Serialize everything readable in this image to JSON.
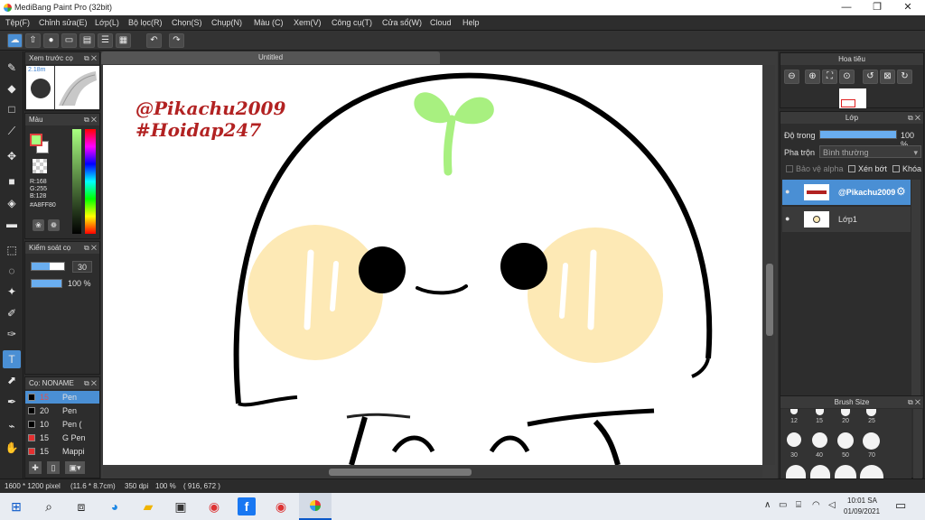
{
  "window": {
    "title": "MediBang Paint Pro (32bit)",
    "minimize": "—",
    "maximize": "❐",
    "close": "✕"
  },
  "menu": [
    "Tệp(F)",
    "Chỉnh sửa(E)",
    "Lớp(L)",
    "Bộ lọc(R)",
    "Chọn(S)",
    "Chụp(N)",
    "Màu (C)",
    "Xem(V)",
    "Công cụ(T)",
    "Cửa sổ(W)",
    "Cloud",
    "Help"
  ],
  "toolbar": {
    "icons": [
      "cloud-icon",
      "share-icon",
      "chat-icon",
      "comment-icon",
      "document-icon",
      "list-icon",
      "grid-icon",
      "undo-icon",
      "redo-icon"
    ]
  },
  "preview": {
    "title": "Xem trước cọ",
    "size": "2.18m"
  },
  "color": {
    "title": "Màu",
    "r": "R:168",
    "g": "G:255",
    "b": "B:128",
    "hex": "#A8FF80",
    "fg": "#a8ff80",
    "bg": "#ffffff"
  },
  "brushctl": {
    "title": "Kiểm soát cọ",
    "size": "30",
    "opacity": "100 %"
  },
  "brushes": {
    "title": "Cọ: NONAME",
    "items": [
      {
        "size": "15",
        "name": "Pen",
        "color": "#000000"
      },
      {
        "size": "20",
        "name": "Pen",
        "color": "#000000"
      },
      {
        "size": "10",
        "name": "Pen (",
        "color": "#000000"
      },
      {
        "size": "15",
        "name": "G Pen",
        "color": "#e53030"
      },
      {
        "size": "15",
        "name": "Mappi",
        "color": "#e53030"
      }
    ]
  },
  "document": {
    "tab": "Untitled",
    "watermark1": "@Pikachu2009",
    "watermark2": "#Hoidap247"
  },
  "navigator": {
    "title": "Hoa tiêu"
  },
  "layer": {
    "title": "Lớp",
    "opacity_label": "Độ trong",
    "opacity_value": "100 %",
    "opacity": 100,
    "blend_label": "Pha trộn",
    "blend_value": "Bình thường",
    "protect_alpha": "Bảo vệ alpha",
    "clipping": "Xén bớt",
    "lock": "Khóa",
    "layers": [
      {
        "name": "@Pikachu2009",
        "selected": true
      },
      {
        "name": "Lớp1",
        "selected": false
      }
    ]
  },
  "brushsize": {
    "title": "Brush Size",
    "row1": [
      "12",
      "15",
      "20",
      "25"
    ],
    "row2": [
      "30",
      "40",
      "50",
      "70"
    ]
  },
  "status": {
    "dimensions": "1600 * 1200 pixel",
    "physical": "(11.6 * 8.7cm)",
    "dpi": "350 dpi",
    "zoom": "100 %",
    "coords": "( 916, 672 )"
  },
  "taskbar": {
    "time": "10:01 SA",
    "date": "01/09/2021"
  },
  "colors": {
    "accent": "#4a8fd4",
    "panel": "#2d2d2d",
    "sprout": "#a8f080",
    "cheek": "#fde9b5",
    "watermark": "#b22222"
  }
}
